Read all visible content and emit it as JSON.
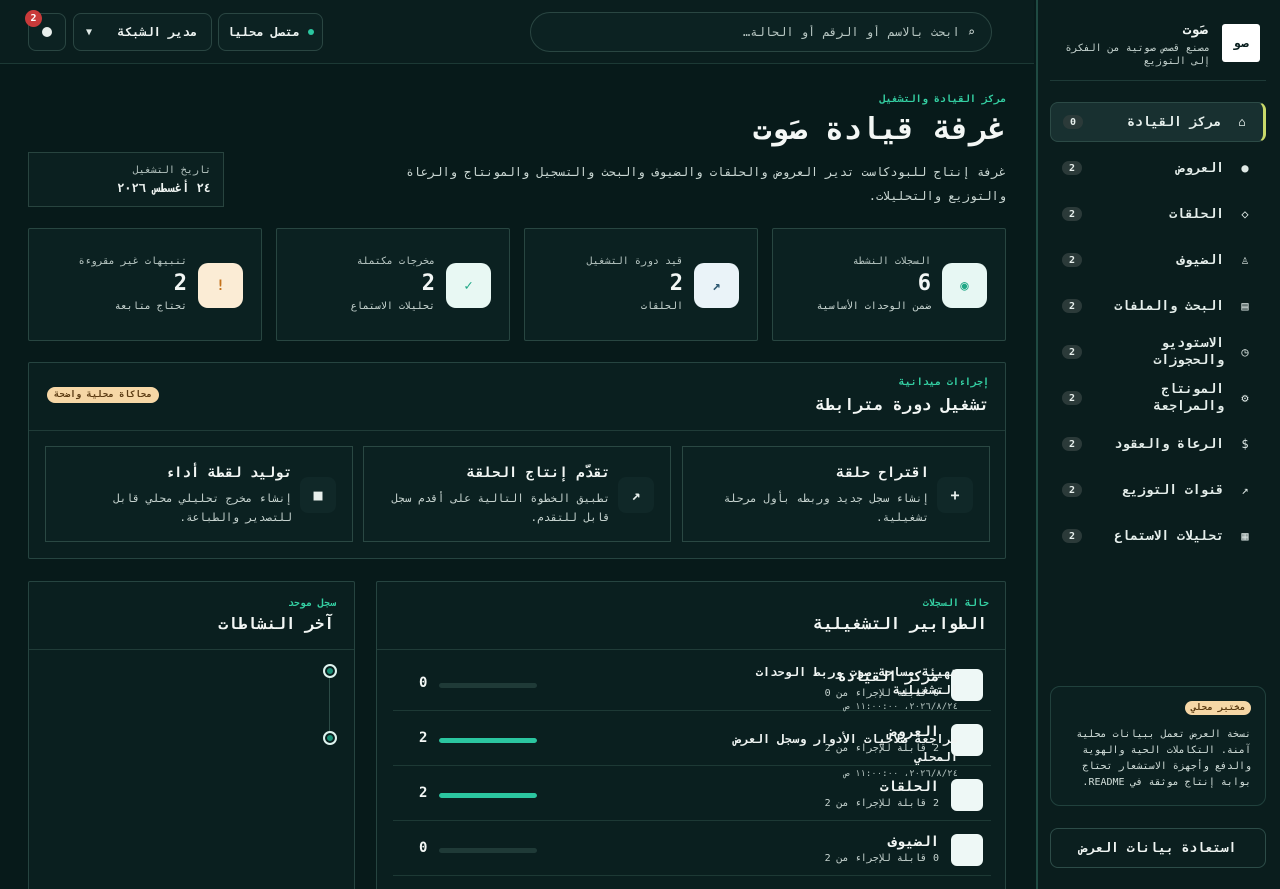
{
  "topbar": {
    "search_placeholder": "ابحث بالاسم أو الرقم أو الحالة…",
    "search_icon": "⌕",
    "connection_status": "متصل محليا",
    "role": "مدير الشبكة",
    "notifications_count": "2"
  },
  "sidebar": {
    "brand_logo": "صو",
    "brand_name": "صَوت",
    "brand_tagline": "مصنع قصص صوتية من الفكرة إلى التوزيع",
    "items": [
      {
        "icon": "⌂",
        "label": "مركز القيادة",
        "badge": "0",
        "active": true
      },
      {
        "icon": "●",
        "label": "العروض",
        "badge": "2"
      },
      {
        "icon": "◇",
        "label": "الحلقات",
        "badge": "2"
      },
      {
        "icon": "♙",
        "label": "الضيوف",
        "badge": "2"
      },
      {
        "icon": "▤",
        "label": "البحث والملفات",
        "badge": "2"
      },
      {
        "icon": "◷",
        "label": "الاستوديو والحجوزات",
        "badge": "2"
      },
      {
        "icon": "⚙",
        "label": "المونتاج والمراجعة",
        "badge": "2"
      },
      {
        "icon": "$",
        "label": "الرعاة والعقود",
        "badge": "2"
      },
      {
        "icon": "↗",
        "label": "قنوات التوزيع",
        "badge": "2"
      },
      {
        "icon": "▦",
        "label": "تحليلات الاستماع",
        "badge": "2"
      }
    ],
    "lab_badge": "مختبر محلي",
    "lab_text": "نسخة العرض تعمل ببيانات محلية آمنة. التكاملات الحية والهوية والدفع وأجهزة الاستشعار تحتاج بوابة إنتاج موثقة في README.",
    "restore_button": "استعادة بيانات العرض"
  },
  "header": {
    "eyebrow": "مركز القيادة والتشغيل",
    "title": "غرفة قيادة صَوت",
    "description": "غرفة إنتاج للبودكاست تدير العروض والحلقات والضيوف والبحث والتسجيل والمونتاج والرعاة والتوزيع والتحليلات.",
    "op_date_label": "تاريخ التشغيل",
    "op_date_value": "٢٤ أغسطس ٢٠٢٦"
  },
  "stats": [
    {
      "icon": "◉",
      "label": "السجلات النشطة",
      "value": "6",
      "hint": "ضمن الوحدات الأساسية",
      "icon_bg": "#e7f7f3",
      "icon_color": "#1ea785"
    },
    {
      "icon": "↗",
      "label": "قيد دورة التشغيل",
      "value": "2",
      "hint": "الحلقات",
      "icon_bg": "#eaf3f8",
      "icon_color": "#2f5a73"
    },
    {
      "icon": "✓",
      "label": "مخرجات مكتملة",
      "value": "2",
      "hint": "تحليلات الاستماع",
      "icon_bg": "#e8f8f3",
      "icon_color": "#1ea785"
    },
    {
      "icon": "!",
      "label": "تنبيهات غير مقروءة",
      "value": "2",
      "hint": "تحتاج متابعة",
      "icon_bg": "#fbecd5",
      "icon_color": "#c4721b"
    }
  ],
  "procedures": {
    "eyebrow": "إجراءات ميدانية",
    "title": "تشغيل دورة مترابطة",
    "pill": "محاكاة محلية واضحة",
    "actions": [
      {
        "icon": "+",
        "title": "اقتراح حلقة",
        "desc": "إنشاء سجل جديد وربطه بأول مرحلة تشغيلية."
      },
      {
        "icon": "↗",
        "title": "تقدّم إنتاج الحلقة",
        "desc": "تطبيق الخطوة التالية على أقدم سجل قابل للتقدم."
      },
      {
        "icon": "■",
        "title": "توليد لقطة أداء",
        "desc": "إنشاء مخرج تحليلي محلي قابل للتصدير والطباعة."
      }
    ]
  },
  "queues": {
    "eyebrow": "حالة السجلات",
    "title": "الطوابير التشغيلية",
    "rows": [
      {
        "name": "مركز القيادة",
        "sub": "0 قابلة للإجراء من 0",
        "count": "0",
        "progress": 0
      },
      {
        "name": "العروض",
        "sub": "2 قابلة للإجراء من 2",
        "count": "2",
        "progress": 1
      },
      {
        "name": "الحلقات",
        "sub": "2 قابلة للإجراء من 2",
        "count": "2",
        "progress": 1
      },
      {
        "name": "الضيوف",
        "sub": "0 قابلة للإجراء من 2",
        "count": "0",
        "progress": 0
      }
    ]
  },
  "activity": {
    "eyebrow": "سجل موحد",
    "title": "آخر النشاطات",
    "items": [
      {
        "title": "تهيئة مساحة صوت وربط الوحدات التشغيلية",
        "time": "٢٠٢٦/٨/٢٤، ١١:٠٠:٠٠ ص"
      },
      {
        "title": "مراجعة صلاحيات الأدوار وسجل العرض المحلي",
        "time": "٢٠٢٦/٨/٢٤، ١١:٠٠:٠٠ ص"
      }
    ]
  }
}
